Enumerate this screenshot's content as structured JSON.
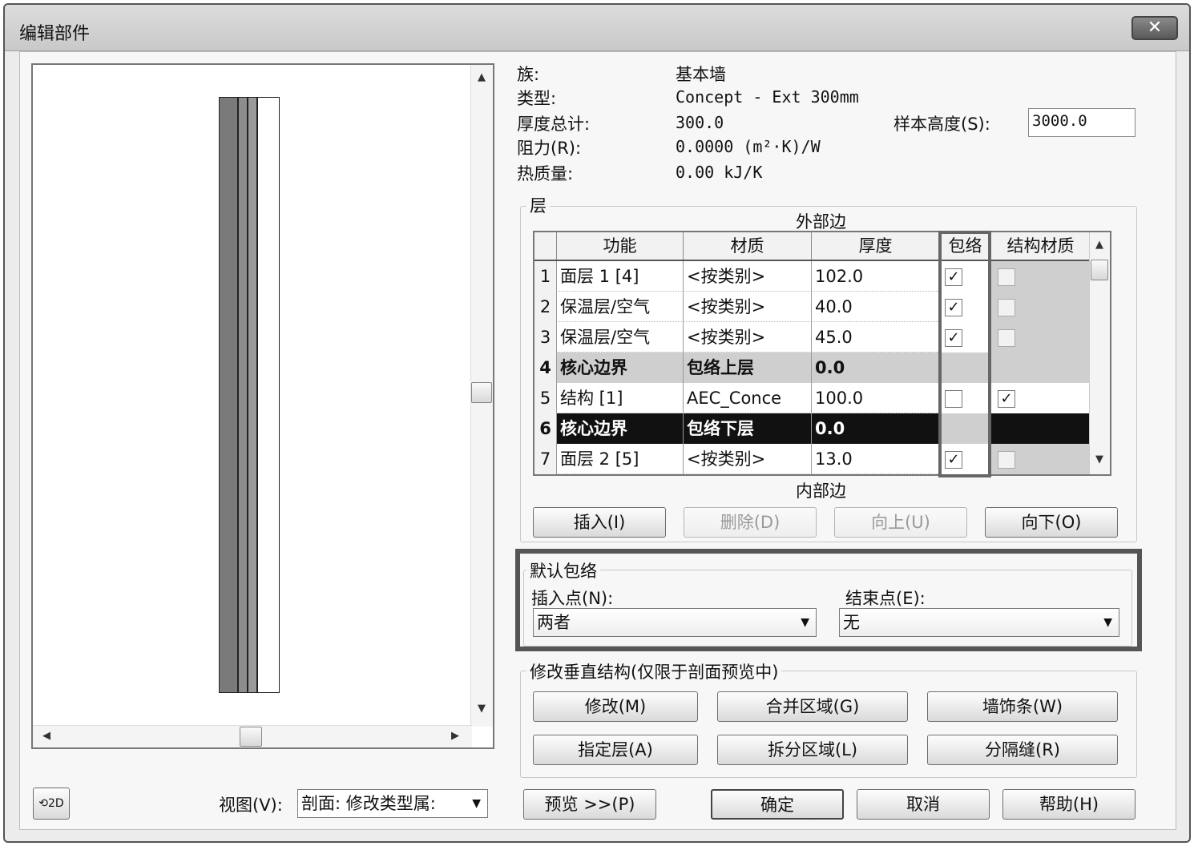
{
  "window": {
    "title": "编辑部件",
    "close_glyph": "✕"
  },
  "info": {
    "family_label": "族:",
    "family_value": "基本墙",
    "type_label": "类型:",
    "type_value": "Concept - Ext 300mm",
    "thickness_label": "厚度总计:",
    "thickness_value": "300.0",
    "resistance_label": "阻力(R):",
    "resistance_value": "0.0000 (m²·K)/W",
    "thermal_label": "热质量:",
    "thermal_value": "0.00 kJ/K",
    "sample_height_label": "样本高度(S):",
    "sample_height_value": "3000.0"
  },
  "layers": {
    "group_title": "层",
    "exterior_label": "外部边",
    "interior_label": "内部边",
    "columns": [
      "功能",
      "材质",
      "厚度",
      "包络",
      "结构材质"
    ],
    "rows": [
      {
        "num": "1",
        "function": "面层 1 [4]",
        "material": "<按类别>",
        "thickness": "102.0",
        "wrap": true,
        "structural": false,
        "kind": "normal"
      },
      {
        "num": "2",
        "function": "保温层/空气",
        "material": "<按类别>",
        "thickness": "40.0",
        "wrap": true,
        "structural": false,
        "kind": "normal"
      },
      {
        "num": "3",
        "function": "保温层/空气",
        "material": "<按类别>",
        "thickness": "45.0",
        "wrap": true,
        "structural": false,
        "kind": "normal"
      },
      {
        "num": "4",
        "function": "核心边界",
        "material": "包络上层",
        "thickness": "0.0",
        "wrap": null,
        "structural": null,
        "kind": "core"
      },
      {
        "num": "5",
        "function": "结构 [1]",
        "material": "AEC_Conce",
        "thickness": "100.0",
        "wrap": false,
        "structural": true,
        "kind": "normal"
      },
      {
        "num": "6",
        "function": "核心边界",
        "material": "包络下层",
        "thickness": "0.0",
        "wrap": null,
        "structural": null,
        "kind": "selected"
      },
      {
        "num": "7",
        "function": "面层 2 [5]",
        "material": "<按类别>",
        "thickness": "13.0",
        "wrap": true,
        "structural": false,
        "kind": "normal"
      }
    ],
    "buttons": {
      "insert": "插入(I)",
      "delete": "删除(D)",
      "up": "向上(U)",
      "down": "向下(O)"
    }
  },
  "default_wrap": {
    "group_title": "默认包络",
    "insert_label": "插入点(N):",
    "insert_value": "两者",
    "end_label": "结束点(E):",
    "end_value": "无"
  },
  "vertical": {
    "group_title": "修改垂直结构(仅限于剖面预览中)",
    "modify": "修改(M)",
    "merge": "合并区域(G)",
    "sweeps": "墙饰条(W)",
    "assign": "指定层(A)",
    "split": "拆分区域(L)",
    "reveals": "分隔缝(R)"
  },
  "bottom": {
    "view_label": "视图(V):",
    "view_value": "剖面: 修改类型属:",
    "preview": "预览 >>(P)",
    "ok": "确定",
    "cancel": "取消",
    "help": "帮助(H)"
  },
  "colors": {
    "wall_dark": "#7a7a7a",
    "wall_mid": "#9a9a9a",
    "selected_row": "#111111",
    "core_row": "#cfcfcf"
  }
}
